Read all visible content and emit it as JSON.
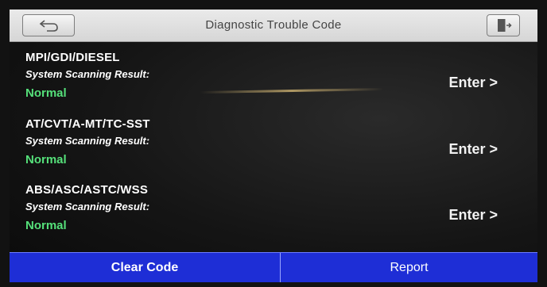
{
  "header": {
    "title": "Diagnostic Trouble Code",
    "back_icon": "back-arrow-icon",
    "exit_icon": "exit-door-icon"
  },
  "systems": [
    {
      "name": "MPI/GDI/DIESEL",
      "label": "System Scanning Result:",
      "status": "Normal",
      "action": "Enter >"
    },
    {
      "name": "AT/CVT/A-MT/TC-SST",
      "label": "System Scanning Result:",
      "status": "Normal",
      "action": "Enter >"
    },
    {
      "name": "ABS/ASC/ASTC/WSS",
      "label": "System Scanning Result:",
      "status": "Normal",
      "action": "Enter >"
    }
  ],
  "footer": {
    "clear_label": "Clear Code",
    "report_label": "Report"
  },
  "colors": {
    "status_normal": "#55e07a",
    "footer_bg": "#1e2ed6",
    "header_bg": "#e0e0e0"
  }
}
